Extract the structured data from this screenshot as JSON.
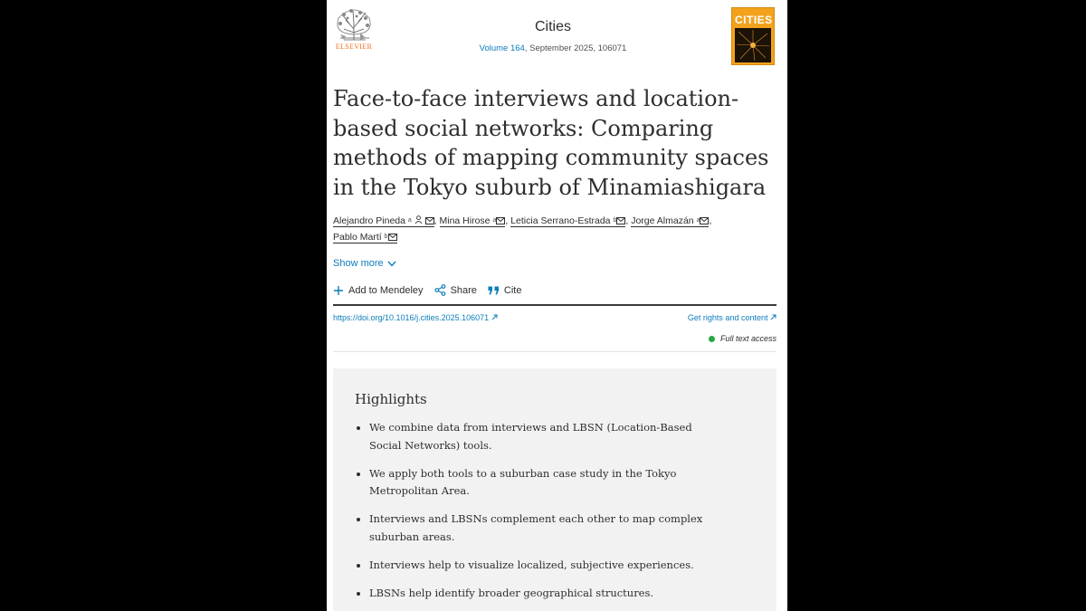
{
  "header": {
    "publisher": "ELSEVIER",
    "journal": "Cities",
    "volume_link": "Volume 164",
    "issue_info": ", September 2025, 106071",
    "cover_title": "CITIES"
  },
  "article": {
    "title": "Face-to-face interviews and location-based social networks: Comparing methods of mapping community spaces in the Tokyo suburb of Minamiashigara",
    "authors": [
      {
        "name": "Alejandro Pineda",
        "aff": "a"
      },
      {
        "name": "Mina Hirose",
        "aff": "a"
      },
      {
        "name": "Leticia Serrano-Estrada",
        "aff": "b"
      },
      {
        "name": "Jorge Almazán",
        "aff": "a"
      },
      {
        "name": "Pablo Martí",
        "aff": "b"
      }
    ],
    "show_more": "Show more"
  },
  "actions": {
    "mendeley": "Add to Mendeley",
    "share": "Share",
    "cite": "Cite"
  },
  "links": {
    "doi": "https://doi.org/10.1016/j.cities.2025.106071",
    "rights": "Get rights and content",
    "access": "Full text access"
  },
  "highlights": {
    "title": "Highlights",
    "items": [
      "We combine data from interviews and LBSN (Location-Based Social Networks) tools.",
      "We apply both tools to a suburban case study in the Tokyo Metropolitan Area.",
      "Interviews and LBSNs complement each other to map complex suburban areas.",
      "Interviews help to visualize localized, subjective experiences.",
      "LBSNs help identify broader geographical structures."
    ]
  },
  "colors": {
    "link": "#0c7dbb",
    "publisher": "#e9711c",
    "access_dot": "#29a745",
    "highlight_bg": "#f2f2f2"
  }
}
